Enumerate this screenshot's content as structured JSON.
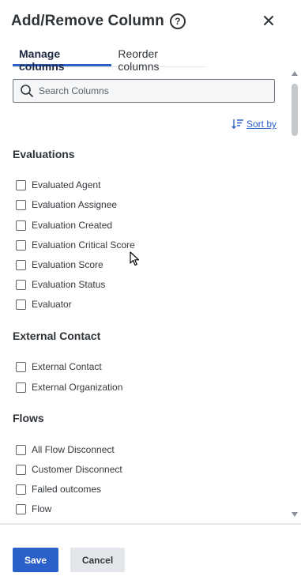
{
  "header": {
    "title": "Add/Remove Column",
    "help_icon": "question-circle-icon",
    "close_icon": "close-icon"
  },
  "tabs": [
    {
      "label": "Manage columns",
      "active": true
    },
    {
      "label": "Reorder columns",
      "active": false
    }
  ],
  "search": {
    "placeholder": "Search Columns",
    "value": ""
  },
  "sort": {
    "label": "Sort by",
    "icon": "sort-descending-icon"
  },
  "groups": [
    {
      "title": "Evaluations",
      "items": [
        "Evaluated Agent",
        "Evaluation Assignee",
        "Evaluation Created",
        "Evaluation Critical Score",
        "Evaluation Score",
        "Evaluation Status",
        "Evaluator"
      ]
    },
    {
      "title": "External Contact",
      "items": [
        "External Contact",
        "External Organization"
      ]
    },
    {
      "title": "Flows",
      "items": [
        "All Flow Disconnect",
        "Customer Disconnect",
        "Failed outcomes",
        "Flow"
      ]
    }
  ],
  "footer": {
    "save_label": "Save",
    "cancel_label": "Cancel"
  },
  "colors": {
    "accent": "#2a60c8",
    "text": "#33383d",
    "secondary_button": "#e3e6ea"
  }
}
